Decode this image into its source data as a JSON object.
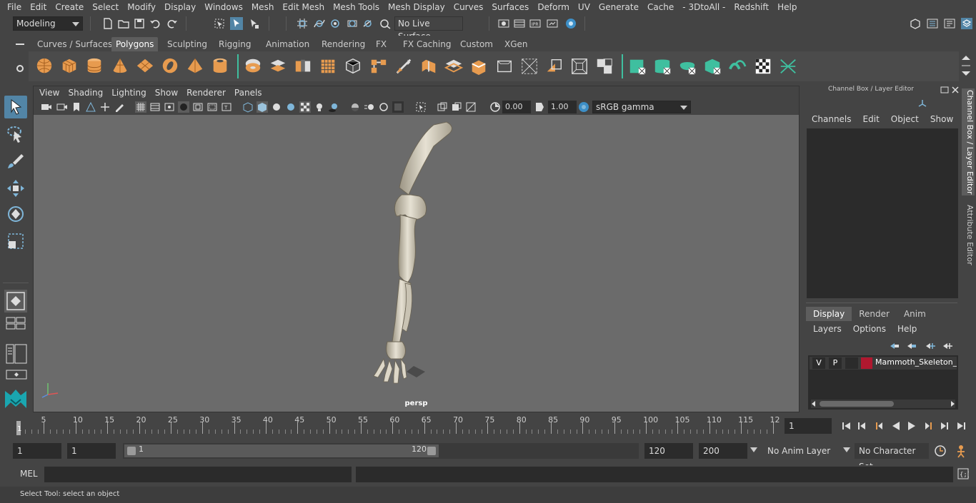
{
  "menubar": [
    "File",
    "Edit",
    "Create",
    "Select",
    "Modify",
    "Display",
    "Windows",
    "Mesh",
    "Edit Mesh",
    "Mesh Tools",
    "Mesh Display",
    "Curves",
    "Surfaces",
    "Deform",
    "UV",
    "Generate",
    "Cache",
    "- 3DtoAll -",
    "Redshift",
    "Help"
  ],
  "status": {
    "mode": "Modeling",
    "live_surface": "No Live Surface"
  },
  "shelf_tabs": [
    "Curves / Surfaces",
    "Polygons",
    "Sculpting",
    "Rigging",
    "Animation",
    "Rendering",
    "FX",
    "FX Caching",
    "Custom",
    "XGen"
  ],
  "shelf_active": "Polygons",
  "viewport": {
    "menu": [
      "View",
      "Shading",
      "Lighting",
      "Show",
      "Renderer",
      "Panels"
    ],
    "exposure": "0.00",
    "gamma": "1.00",
    "color_space": "sRGB gamma",
    "camera": "persp"
  },
  "channel_box": {
    "title": "Channel Box / Layer Editor",
    "menu": [
      "Channels",
      "Edit",
      "Object",
      "Show"
    ],
    "layer_tabs": [
      "Display",
      "Render",
      "Anim"
    ],
    "layer_tab_active": "Display",
    "layer_menu": [
      "Layers",
      "Options",
      "Help"
    ],
    "layer": {
      "v": "V",
      "p": "P",
      "name": "Mammoth_Skeleton_C",
      "color": "#b0182f"
    }
  },
  "side_tabs": [
    "Channel Box / Layer Editor",
    "Attribute Editor"
  ],
  "timeline": {
    "ticks": [
      "5",
      "10",
      "15",
      "20",
      "25",
      "30",
      "35",
      "40",
      "45",
      "50",
      "55",
      "60",
      "65",
      "70",
      "75",
      "80",
      "85",
      "90",
      "95",
      "100",
      "105",
      "110",
      "115",
      "12"
    ],
    "start_marker": "1",
    "current_frame": "1"
  },
  "range": {
    "start": "1",
    "playback_start": "1",
    "slider_start": "1",
    "slider_end": "120",
    "playback_end": "120",
    "end": "200",
    "anim_layer": "No Anim Layer",
    "character_set": "No Character Set"
  },
  "command": {
    "lang": "MEL"
  },
  "help_line": "Select Tool: select an object",
  "colors": {
    "accent": "#5285a6",
    "shelf_orange": "#e79b4f",
    "shelf_green": "#3fbf9f"
  }
}
